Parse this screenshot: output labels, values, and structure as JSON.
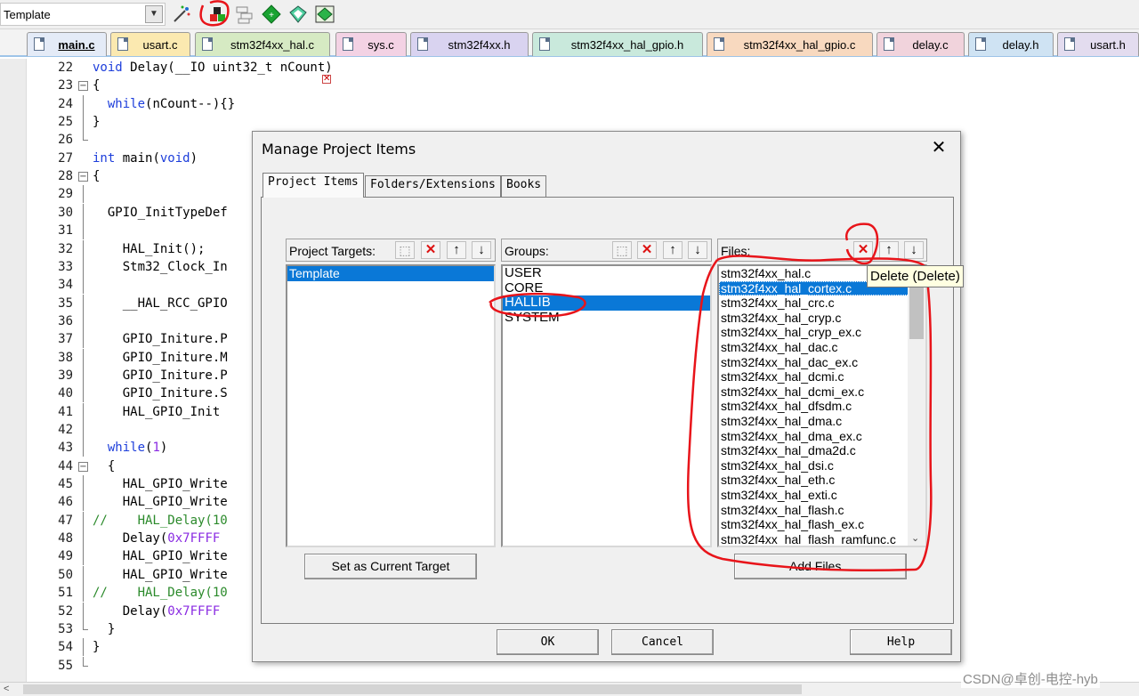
{
  "toolbar": {
    "target_value": "Template",
    "icons": [
      "magic-wand-icon",
      "manage-project-items-icon",
      "build-stack-icon",
      "diamond-green-icon",
      "diamond-outline-icon",
      "diamond-multi-icon"
    ]
  },
  "tabs": [
    {
      "label": "main.c",
      "active": true,
      "color": "#e4ebf7"
    },
    {
      "label": "usart.c",
      "color": "#fbe9b0"
    },
    {
      "label": "stm32f4xx_hal.c",
      "color": "#d6eac3"
    },
    {
      "label": "sys.c",
      "color": "#f3d2e4"
    },
    {
      "label": "stm32f4xx.h",
      "color": "#d9d3f0"
    },
    {
      "label": "stm32f4xx_hal_gpio.h",
      "color": "#c9e9dc"
    },
    {
      "label": "stm32f4xx_hal_gpio.c",
      "color": "#f8d9bf"
    },
    {
      "label": "delay.c",
      "color": "#f1d3dc"
    },
    {
      "label": "delay.h",
      "color": "#cfe3f3"
    },
    {
      "label": "usart.h",
      "color": "#e3dcef"
    }
  ],
  "code": [
    {
      "n": "22",
      "fold": "",
      "html": "<span class=\"kw\">void</span> Delay(__IO uint32_t nCount)"
    },
    {
      "n": "23",
      "fold": "open",
      "html": "{"
    },
    {
      "n": "24",
      "fold": "line",
      "html": "  <span class=\"kw\">while</span>(nCount--){}"
    },
    {
      "n": "25",
      "fold": "line",
      "html": "}"
    },
    {
      "n": "26",
      "fold": "end",
      "html": ""
    },
    {
      "n": "27",
      "fold": "",
      "html": "<span class=\"kw\">int</span> main(<span class=\"kw\">void</span>)"
    },
    {
      "n": "28",
      "fold": "open",
      "html": "{"
    },
    {
      "n": "29",
      "fold": "line",
      "html": ""
    },
    {
      "n": "30",
      "fold": "line",
      "html": "  GPIO_InitTypeDef"
    },
    {
      "n": "31",
      "fold": "line",
      "html": ""
    },
    {
      "n": "32",
      "fold": "line",
      "html": "    HAL_Init();"
    },
    {
      "n": "33",
      "fold": "line",
      "html": "    Stm32_Clock_In"
    },
    {
      "n": "34",
      "fold": "line",
      "html": ""
    },
    {
      "n": "35",
      "fold": "line",
      "html": "    __HAL_RCC_GPIO"
    },
    {
      "n": "36",
      "fold": "line",
      "html": ""
    },
    {
      "n": "37",
      "fold": "line",
      "html": "    GPIO_Initure.P"
    },
    {
      "n": "38",
      "fold": "line",
      "html": "    GPIO_Initure.M"
    },
    {
      "n": "39",
      "fold": "line",
      "html": "    GPIO_Initure.P"
    },
    {
      "n": "40",
      "fold": "line",
      "html": "    GPIO_Initure.S"
    },
    {
      "n": "41",
      "fold": "line",
      "html": "    HAL_GPIO_Init"
    },
    {
      "n": "42",
      "fold": "line",
      "html": ""
    },
    {
      "n": "43",
      "fold": "line",
      "html": "  <span class=\"kw\">while</span>(<span class=\"num\">1</span>)"
    },
    {
      "n": "44",
      "fold": "open",
      "html": "  {"
    },
    {
      "n": "45",
      "fold": "line",
      "html": "    HAL_GPIO_Write"
    },
    {
      "n": "46",
      "fold": "line",
      "html": "    HAL_GPIO_Write"
    },
    {
      "n": "47",
      "fold": "line",
      "html": "<span class=\"cm\">//    HAL_Delay(10</span>"
    },
    {
      "n": "48",
      "fold": "line",
      "html": "    Delay(<span class=\"num\">0x7FFFF</span>"
    },
    {
      "n": "49",
      "fold": "line",
      "html": "    HAL_GPIO_Write"
    },
    {
      "n": "50",
      "fold": "line",
      "html": "    HAL_GPIO_Write"
    },
    {
      "n": "51",
      "fold": "line",
      "html": "<span class=\"cm\">//    HAL_Delay(10</span>"
    },
    {
      "n": "52",
      "fold": "line",
      "html": "    Delay(<span class=\"num\">0x7FFFF</span>"
    },
    {
      "n": "53",
      "fold": "end",
      "html": "  }"
    },
    {
      "n": "54",
      "fold": "line",
      "html": "}"
    },
    {
      "n": "55",
      "fold": "end",
      "html": ""
    }
  ],
  "dialog": {
    "title": "Manage Project Items",
    "tabs": [
      "Project Items",
      "Folders/Extensions",
      "Books"
    ],
    "targets_header": "Project Targets:",
    "targets": [
      "Template"
    ],
    "groups_header": "Groups:",
    "groups": [
      "USER",
      "CORE",
      "HALLIB",
      "SYSTEM"
    ],
    "files_header": "Files:",
    "files": [
      "stm32f4xx_hal.c",
      "stm32f4xx_hal_cortex.c",
      "stm32f4xx_hal_crc.c",
      "stm32f4xx_hal_cryp.c",
      "stm32f4xx_hal_cryp_ex.c",
      "stm32f4xx_hal_dac.c",
      "stm32f4xx_hal_dac_ex.c",
      "stm32f4xx_hal_dcmi.c",
      "stm32f4xx_hal_dcmi_ex.c",
      "stm32f4xx_hal_dfsdm.c",
      "stm32f4xx_hal_dma.c",
      "stm32f4xx_hal_dma_ex.c",
      "stm32f4xx_hal_dma2d.c",
      "stm32f4xx_hal_dsi.c",
      "stm32f4xx_hal_eth.c",
      "stm32f4xx_hal_exti.c",
      "stm32f4xx_hal_flash.c",
      "stm32f4xx_hal_flash_ex.c",
      "stm32f4xx_hal_flash_ramfunc.c"
    ],
    "tooltip": "Delete (Delete)",
    "set_target_btn": "Set as Current Target",
    "add_files_btn": "Add Files...",
    "ok_btn": "OK",
    "cancel_btn": "Cancel",
    "help_btn": "Help"
  },
  "watermark": "CSDN@卓创-电控-hyb",
  "annotation_color": "#e8141a"
}
